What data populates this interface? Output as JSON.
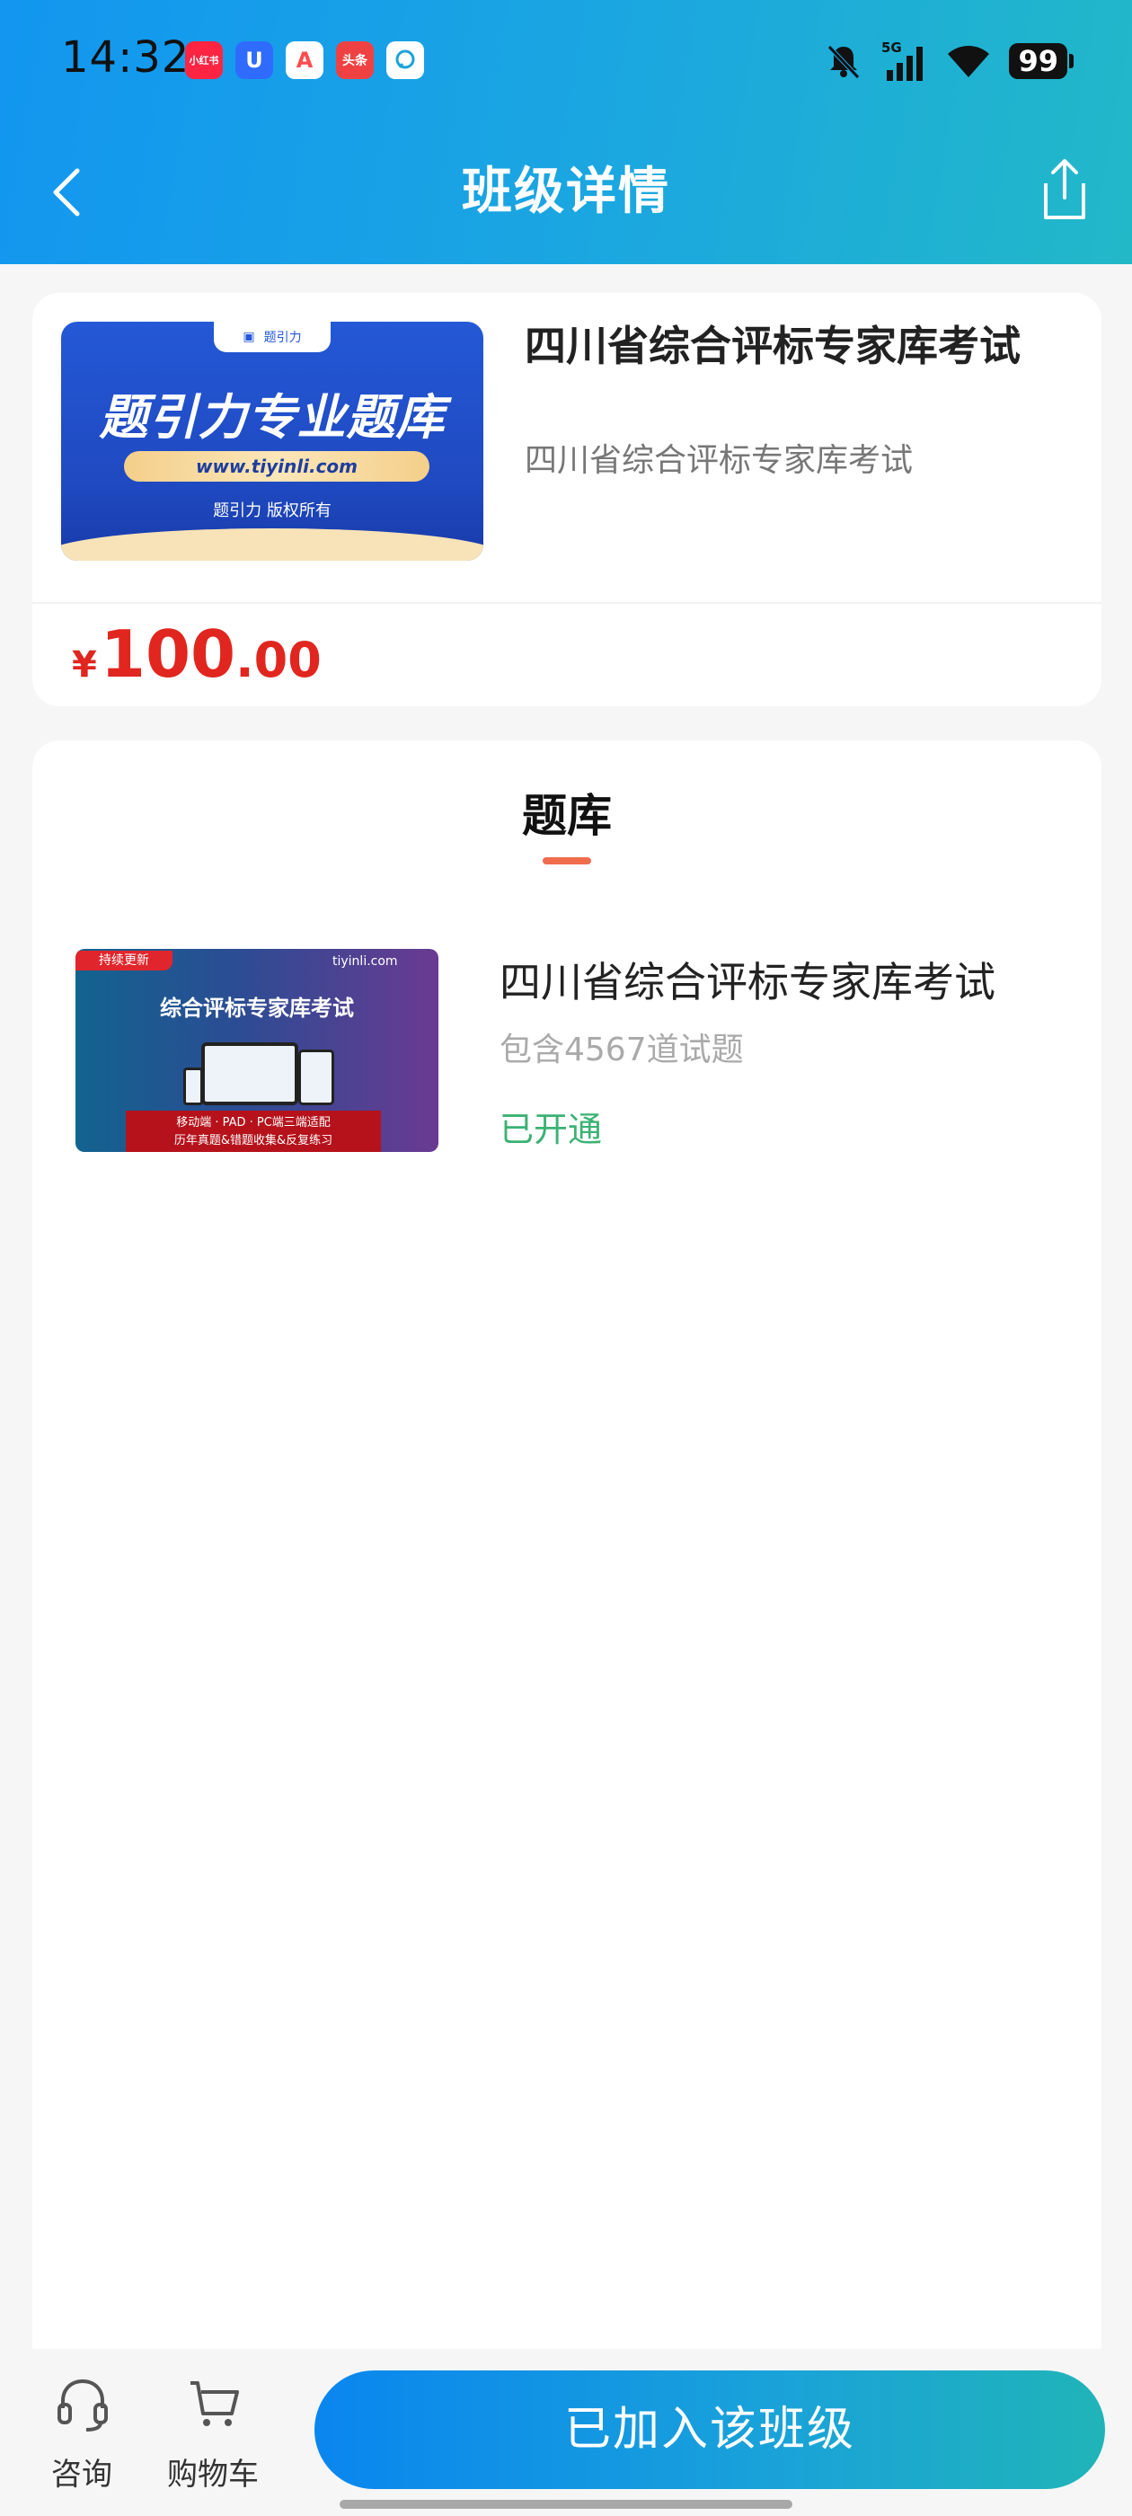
{
  "status_bar": {
    "time": "14:32",
    "apps": [
      {
        "name": "xiaohongshu-icon",
        "label": "小红书",
        "color": "#ff2442"
      },
      {
        "name": "u-app-icon",
        "label": "U",
        "color": "#2f6bff"
      },
      {
        "name": "a-app-icon",
        "label": "A",
        "color": "#ff4d4f"
      },
      {
        "name": "toutiao-icon",
        "label": "头条",
        "color": "#f04142"
      },
      {
        "name": "chat-app-icon",
        "label": "",
        "color": "#ffffff"
      }
    ],
    "network": "5G",
    "battery": "99"
  },
  "header": {
    "title": "班级详情"
  },
  "course": {
    "cover": {
      "tab_label": "题引力",
      "main_text": "题引力专业题库",
      "url": "www.tiyinli.com",
      "copyright": "题引力 版权所有"
    },
    "title": "四川省综合评标专家库考试",
    "subtitle": "四川省综合评标专家库考试",
    "price": {
      "currency": "¥",
      "integer": "100",
      "decimal": ".00"
    }
  },
  "question_bank": {
    "section_title": "题库",
    "items": [
      {
        "thumb": {
          "badge": "持续更新",
          "logo": "tiyinli.com",
          "title": "综合评标专家库考试",
          "footer_line1": "移动端 · PAD · PC端三端适配",
          "footer_line2": "历年真题&错题收集&反复练习"
        },
        "name": "四川省综合评标专家库考试",
        "count": "包含4567道试题",
        "status": "已开通"
      }
    ]
  },
  "bottom_bar": {
    "consult_label": "咨询",
    "cart_label": "购物车",
    "join_label": "已加入该班级"
  },
  "colors": {
    "header_start": "#1296f0",
    "header_end": "#22b8c8",
    "price": "#e0261f",
    "status_green": "#3bb273",
    "accent_underline": "#ef6c4c"
  }
}
